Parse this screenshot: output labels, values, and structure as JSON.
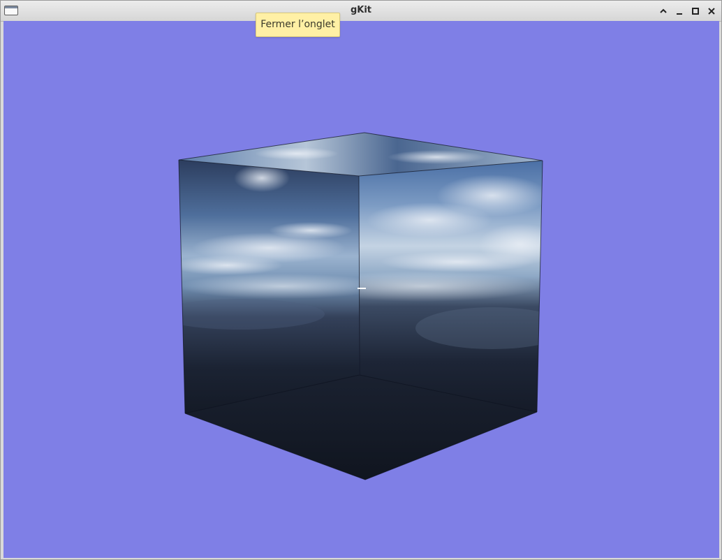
{
  "window": {
    "title": "gKit",
    "icons": {
      "app": "window-icon",
      "shade": "chevron-up-icon",
      "minimize": "minimize-icon",
      "maximize": "maximize-icon",
      "close": "close-icon"
    }
  },
  "tooltip": {
    "text": "Fermer l’onglet"
  },
  "colors": {
    "background": "#7f7fe6",
    "tooltip_bg": "#fff0a5"
  }
}
